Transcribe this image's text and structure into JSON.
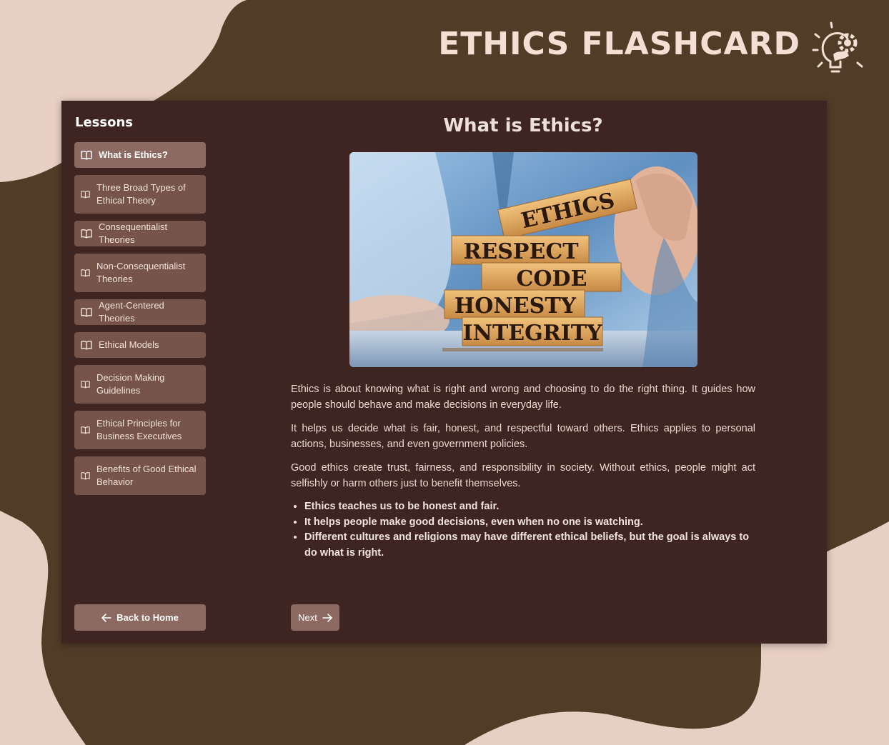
{
  "app": {
    "title": "ETHICS FLASHCARD"
  },
  "sidebar": {
    "heading": "Lessons",
    "items": [
      {
        "label": "What is Ethics?",
        "active": true
      },
      {
        "label": "Three Broad Types of Ethical Theory"
      },
      {
        "label": "Consequentialist Theories"
      },
      {
        "label": "Non-Consequentialist Theories"
      },
      {
        "label": "Agent-Centered Theories"
      },
      {
        "label": "Ethical Models"
      },
      {
        "label": "Decision Making Guidelines"
      },
      {
        "label": "Ethical Principles for Business Executives"
      },
      {
        "label": "Benefits of Good Ethical Behavior"
      }
    ],
    "back_label": "Back to Home"
  },
  "lesson": {
    "title": "What is Ethics?",
    "image_words": [
      "ETHICS",
      "RESPECT",
      "CODE",
      "HONESTY",
      "INTEGRITY"
    ],
    "paragraphs": [
      "Ethics is about knowing what is right and wrong and choosing to do the right thing. It guides how people should behave and make decisions in everyday life.",
      "It helps us decide what is fair, honest, and respectful toward others. Ethics applies to personal actions, businesses, and even government policies.",
      "Good ethics create trust, fairness, and responsibility in society. Without ethics, people might act selfishly or harm others just to benefit themselves."
    ],
    "bullets": [
      "Ethics teaches us to be honest and fair.",
      "It helps people make good decisions, even when no one is watching.",
      "Different cultures and religions may have different ethical beliefs, but the goal is always to do what is right."
    ],
    "next_label": "Next"
  },
  "colors": {
    "page_background": "#e8cfc3",
    "blob": "#523c28",
    "card": "#3e2522",
    "button": "#775449",
    "button_active": "#8c6a61",
    "title_text": "#f3dfd3"
  }
}
